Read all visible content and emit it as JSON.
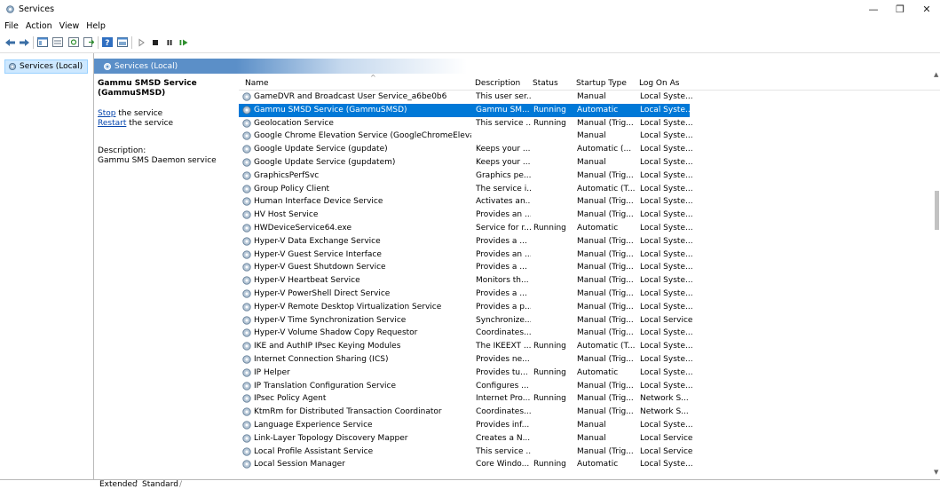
{
  "window": {
    "title": "Services",
    "controls": {
      "minimize": "—",
      "maximize": "❐",
      "close": "✕"
    }
  },
  "menu": [
    "File",
    "Action",
    "View",
    "Help"
  ],
  "tree": {
    "root": "Services (Local)"
  },
  "main": {
    "header": "Services (Local)",
    "selected_service": {
      "title": "Gammu SMSD Service (GammuSMSD)",
      "stop_link": "Stop",
      "stop_suffix": " the service",
      "restart_link": "Restart",
      "restart_suffix": " the service",
      "description_label": "Description:",
      "description": "Gammu SMS Daemon service"
    }
  },
  "table": {
    "columns": {
      "name": "Name",
      "description": "Description",
      "status": "Status",
      "startup": "Startup Type",
      "logon": "Log On As"
    },
    "rows": [
      {
        "name": "GameDVR and Broadcast User Service_a6be0b6",
        "description": "This user ser...",
        "status": "",
        "startup": "Manual",
        "logon": "Local Syste..."
      },
      {
        "name": "Gammu SMSD Service (GammuSMSD)",
        "description": "Gammu SM...",
        "status": "Running",
        "startup": "Automatic",
        "logon": "Local Syste...",
        "selected": true
      },
      {
        "name": "Geolocation Service",
        "description": "This service ...",
        "status": "Running",
        "startup": "Manual (Trig...",
        "logon": "Local Syste..."
      },
      {
        "name": "Google Chrome Elevation Service (GoogleChromeElevati...",
        "description": "",
        "status": "",
        "startup": "Manual",
        "logon": "Local Syste..."
      },
      {
        "name": "Google Update Service (gupdate)",
        "description": "Keeps your ...",
        "status": "",
        "startup": "Automatic (...",
        "logon": "Local Syste..."
      },
      {
        "name": "Google Update Service (gupdatem)",
        "description": "Keeps your ...",
        "status": "",
        "startup": "Manual",
        "logon": "Local Syste..."
      },
      {
        "name": "GraphicsPerfSvc",
        "description": "Graphics pe...",
        "status": "",
        "startup": "Manual (Trig...",
        "logon": "Local Syste..."
      },
      {
        "name": "Group Policy Client",
        "description": "The service i...",
        "status": "",
        "startup": "Automatic (T...",
        "logon": "Local Syste..."
      },
      {
        "name": "Human Interface Device Service",
        "description": "Activates an...",
        "status": "",
        "startup": "Manual (Trig...",
        "logon": "Local Syste..."
      },
      {
        "name": "HV Host Service",
        "description": "Provides an ...",
        "status": "",
        "startup": "Manual (Trig...",
        "logon": "Local Syste..."
      },
      {
        "name": "HWDeviceService64.exe",
        "description": "Service for r...",
        "status": "Running",
        "startup": "Automatic",
        "logon": "Local Syste..."
      },
      {
        "name": "Hyper-V Data Exchange Service",
        "description": "Provides a ...",
        "status": "",
        "startup": "Manual (Trig...",
        "logon": "Local Syste..."
      },
      {
        "name": "Hyper-V Guest Service Interface",
        "description": "Provides an ...",
        "status": "",
        "startup": "Manual (Trig...",
        "logon": "Local Syste..."
      },
      {
        "name": "Hyper-V Guest Shutdown Service",
        "description": "Provides a ...",
        "status": "",
        "startup": "Manual (Trig...",
        "logon": "Local Syste..."
      },
      {
        "name": "Hyper-V Heartbeat Service",
        "description": "Monitors th...",
        "status": "",
        "startup": "Manual (Trig...",
        "logon": "Local Syste..."
      },
      {
        "name": "Hyper-V PowerShell Direct Service",
        "description": "Provides a ...",
        "status": "",
        "startup": "Manual (Trig...",
        "logon": "Local Syste..."
      },
      {
        "name": "Hyper-V Remote Desktop Virtualization Service",
        "description": "Provides a p...",
        "status": "",
        "startup": "Manual (Trig...",
        "logon": "Local Syste..."
      },
      {
        "name": "Hyper-V Time Synchronization Service",
        "description": "Synchronize...",
        "status": "",
        "startup": "Manual (Trig...",
        "logon": "Local Service"
      },
      {
        "name": "Hyper-V Volume Shadow Copy Requestor",
        "description": "Coordinates...",
        "status": "",
        "startup": "Manual (Trig...",
        "logon": "Local Syste..."
      },
      {
        "name": "IKE and AuthIP IPsec Keying Modules",
        "description": "The IKEEXT ...",
        "status": "Running",
        "startup": "Automatic (T...",
        "logon": "Local Syste..."
      },
      {
        "name": "Internet Connection Sharing (ICS)",
        "description": "Provides ne...",
        "status": "",
        "startup": "Manual (Trig...",
        "logon": "Local Syste..."
      },
      {
        "name": "IP Helper",
        "description": "Provides tu...",
        "status": "Running",
        "startup": "Automatic",
        "logon": "Local Syste..."
      },
      {
        "name": "IP Translation Configuration Service",
        "description": "Configures ...",
        "status": "",
        "startup": "Manual (Trig...",
        "logon": "Local Syste..."
      },
      {
        "name": "IPsec Policy Agent",
        "description": "Internet Pro...",
        "status": "Running",
        "startup": "Manual (Trig...",
        "logon": "Network S..."
      },
      {
        "name": "KtmRm for Distributed Transaction Coordinator",
        "description": "Coordinates...",
        "status": "",
        "startup": "Manual (Trig...",
        "logon": "Network S..."
      },
      {
        "name": "Language Experience Service",
        "description": "Provides inf...",
        "status": "",
        "startup": "Manual",
        "logon": "Local Syste..."
      },
      {
        "name": "Link-Layer Topology Discovery Mapper",
        "description": "Creates a N...",
        "status": "",
        "startup": "Manual",
        "logon": "Local Service"
      },
      {
        "name": "Local Profile Assistant Service",
        "description": "This service ...",
        "status": "",
        "startup": "Manual (Trig...",
        "logon": "Local Service"
      },
      {
        "name": "Local Session Manager",
        "description": "Core Windo...",
        "status": "Running",
        "startup": "Automatic",
        "logon": "Local Syste..."
      }
    ]
  },
  "tabs": [
    "Extended",
    "Standard"
  ]
}
